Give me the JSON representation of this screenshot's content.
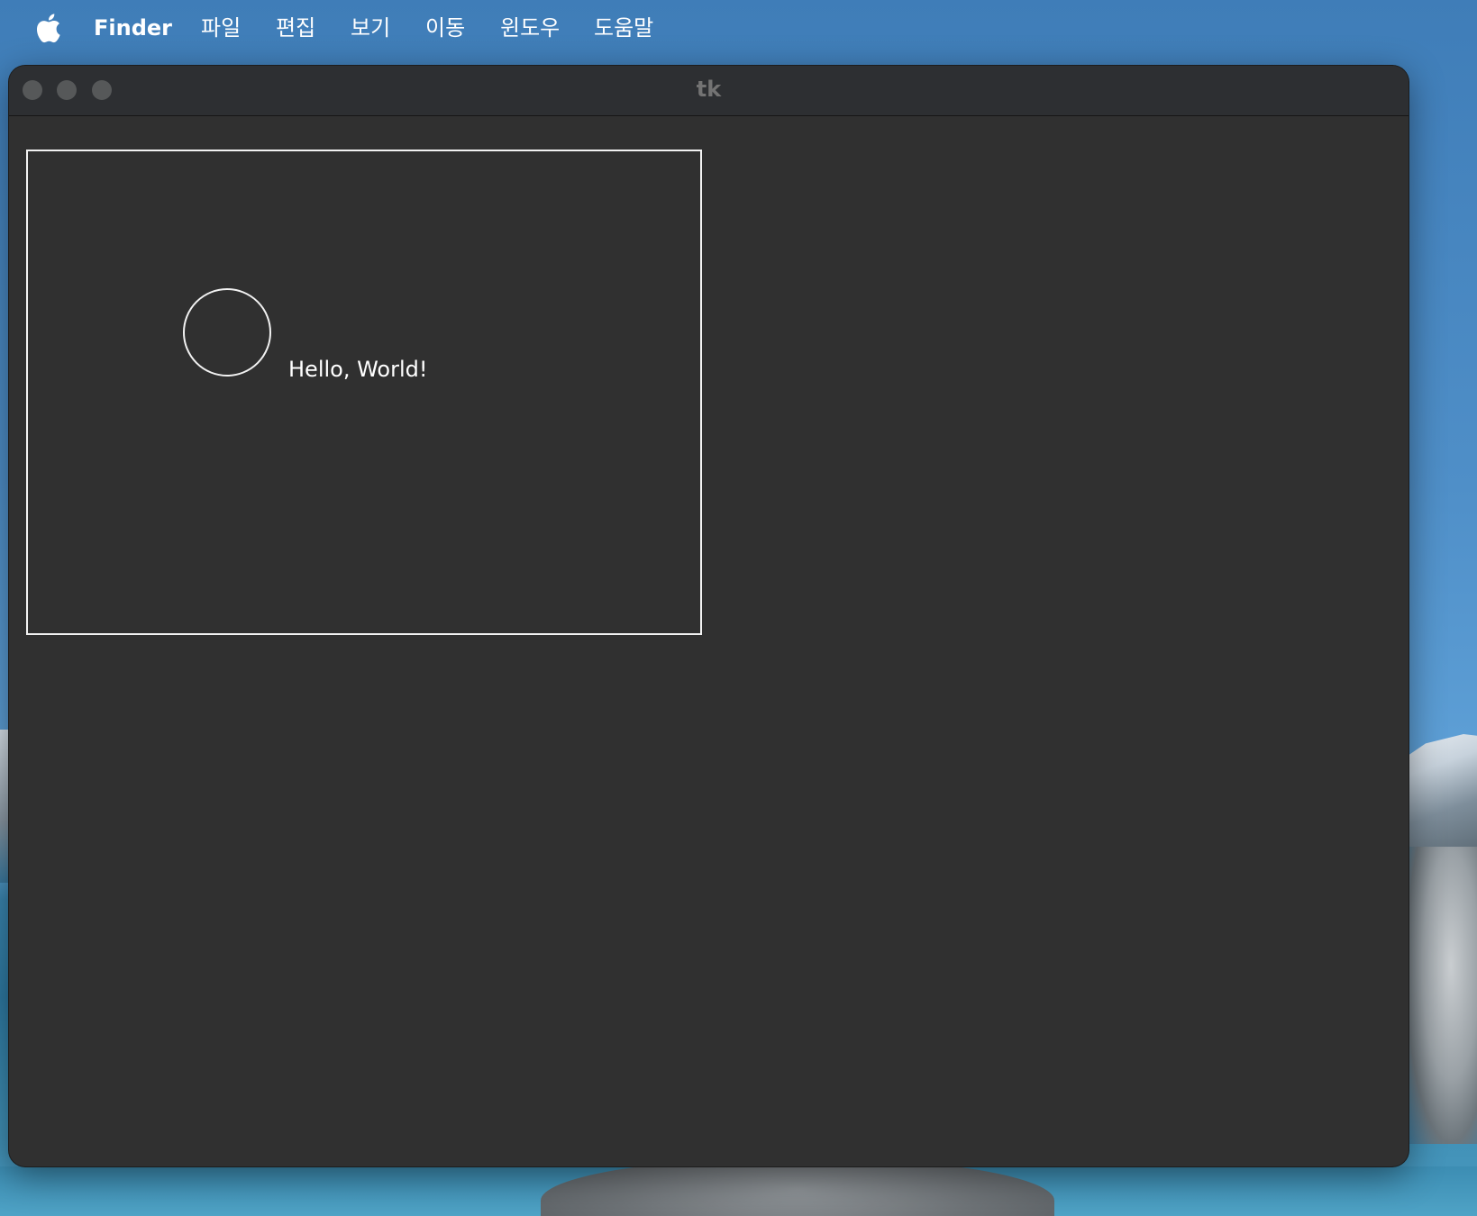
{
  "menubar": {
    "app_name": "Finder",
    "items": [
      "파일",
      "편집",
      "보기",
      "이동",
      "윈도우",
      "도움말"
    ],
    "apple_icon": "apple-logo-icon"
  },
  "window": {
    "title": "tk",
    "traffic_lights": [
      "close",
      "minimize",
      "zoom"
    ],
    "canvas": {
      "text": "Hello, World!",
      "shapes": [
        "rectangle",
        "circle"
      ]
    }
  },
  "colors": {
    "window_bg": "#303030",
    "titlebar_bg": "#2d2f32",
    "canvas_stroke": "#f2f2f2",
    "traffic_light_inactive": "#565859"
  }
}
